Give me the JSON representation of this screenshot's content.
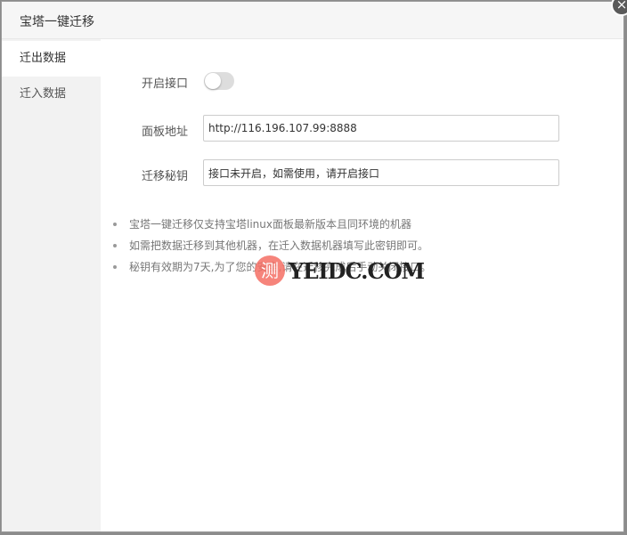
{
  "dialog": {
    "title": "宝塔一键迁移",
    "close_icon": "×"
  },
  "sidebar": {
    "items": [
      {
        "label": "迁出数据",
        "active": true
      },
      {
        "label": "迁入数据",
        "active": false
      }
    ]
  },
  "form": {
    "api_toggle_label": "开启接口",
    "api_toggle_on": false,
    "panel_address_label": "面板地址",
    "panel_address_value": "http://116.196.107.99:8888",
    "migration_key_label": "迁移秘钥",
    "migration_key_value": "接口未开启，如需使用，请开启接口"
  },
  "notes": [
    "宝塔一键迁移仅支持宝塔linux面板最新版本且同环境的机器",
    "如需把数据迁移到其他机器，在迁入数据机器填写此密钥即可。",
    "秘钥有效期为7天,为了您的安全,请在迁移完成后手动关闭接口。"
  ],
  "watermark": {
    "glyph": "测",
    "text": "YEIDC.COM"
  },
  "colors": {
    "toggle_off": "#dddddd",
    "sidebar_bg": "#f2f2f2",
    "watermark_accent": "#f46e64"
  }
}
